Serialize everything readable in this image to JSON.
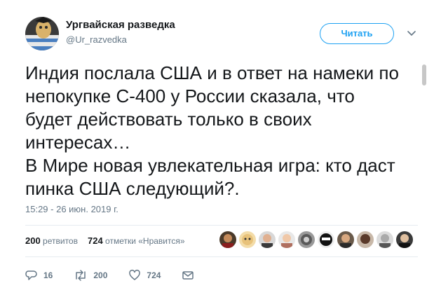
{
  "author": {
    "display_name": "Ургвайская разведка",
    "handle": "@Ur_razvedka"
  },
  "follow_button": {
    "label": "Читать"
  },
  "tweet": {
    "text": "Индия послала США и в ответ на намеки по\nнепокупке С-400 у России сказала, что\nбудет действовать только в своих\nинтересах…\nВ Мире новая увлекательная игра: кто даст\nпинка США следующий?.",
    "timestamp": "15:29 - 26 июн. 2019 г."
  },
  "stats": {
    "retweets_count": "200",
    "retweets_label": "ретвитов",
    "likes_count": "724",
    "likes_label": "отметки «Нравится»"
  },
  "actions": {
    "reply_count": "16",
    "retweet_count": "200",
    "like_count": "724"
  },
  "colors": {
    "accent": "#1da1f2",
    "muted": "#657786",
    "text": "#14171a",
    "border": "#e6ecf0"
  }
}
